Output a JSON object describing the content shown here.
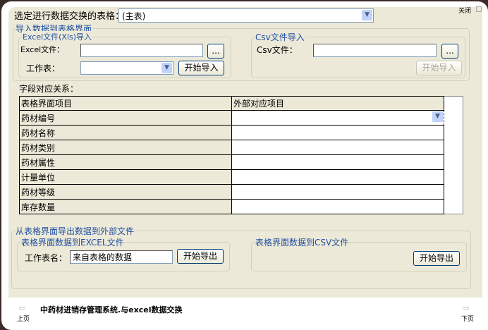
{
  "header": {
    "select_label": "选定进行数据交换的表格：",
    "select_value": "(主表)",
    "close_label": "关闭"
  },
  "import": {
    "title": "导入数据到表格界面",
    "excel": {
      "title": "Excel文件(Xls)导入",
      "file_label": "Excel文件：",
      "file_value": "",
      "browse": "...",
      "sheet_label": "工作表：",
      "sheet_value": "",
      "start": "开始导入"
    },
    "csv": {
      "title": "Csv文件导入",
      "file_label": "Csv文件：",
      "file_value": "",
      "browse": "...",
      "start": "开始导入"
    }
  },
  "mapping": {
    "label": "字段对应关系：",
    "columns": [
      "表格界面项目",
      "外部对应项目"
    ],
    "rows": [
      "药材编号",
      "药材名称",
      "药材类别",
      "药材属性",
      "计量单位",
      "药材等级",
      "库存数量"
    ]
  },
  "export": {
    "title": "从表格界面导出数据到外部文件",
    "excel": {
      "title": "表格界面数据到EXCEL文件",
      "sheet_label": "工作表名：",
      "sheet_value": "来自表格的数据",
      "start": "开始导出"
    },
    "csv": {
      "title": "表格界面数据到CSV文件",
      "start": "开始导出"
    }
  },
  "footer": {
    "title": "中药材进销存管理系统.与excel数据交换",
    "prev": "上页",
    "next": "下页"
  }
}
